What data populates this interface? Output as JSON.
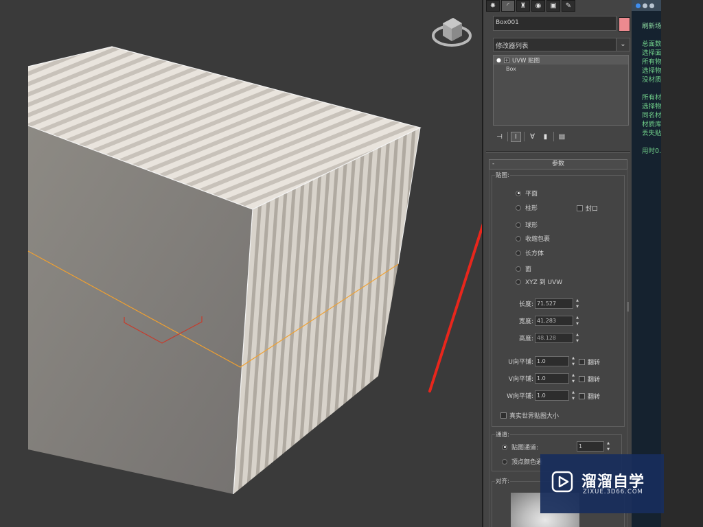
{
  "command_panel": {
    "tabs": [
      {
        "icon": "create-icon",
        "glyph": "✸"
      },
      {
        "icon": "modify-icon",
        "glyph": "◜"
      },
      {
        "icon": "hierarchy-icon",
        "glyph": "♜"
      },
      {
        "icon": "motion-icon",
        "glyph": "◉"
      },
      {
        "icon": "display-icon",
        "glyph": "▣"
      },
      {
        "icon": "utilities-icon",
        "glyph": "✎"
      }
    ],
    "object_name": "Box001",
    "object_color": "#ec8a8f",
    "modifier_list_label": "修改器列表",
    "modifier_stack": [
      {
        "label": "UVW 贴图"
      },
      {
        "label": "Box"
      }
    ],
    "parameters_rollout": {
      "title": "参数",
      "mapping_group_label": "贴图:",
      "mapping_options": [
        "平面",
        "柱形",
        "球形",
        "收缩包裹",
        "长方体",
        "面",
        "XYZ 到 UVW"
      ],
      "selected_mapping": "平面",
      "cap_label": "封口",
      "length_label": "长度:",
      "length_value": "71.527",
      "width_label": "宽度:",
      "width_value": "41.283",
      "height_label": "高度:",
      "height_value": "48.128",
      "u_tile_label": "U向平铺:",
      "u_tile_value": "1.0",
      "v_tile_label": "V向平铺:",
      "v_tile_value": "1.0",
      "w_tile_label": "W向平铺:",
      "w_tile_value": "1.0",
      "flip_label": "翻转",
      "real_world_label": "真实世界贴图大小",
      "channel_group_label": "通道:",
      "map_channel_label": "贴图通道:",
      "map_channel_value": "1",
      "vertex_color_label": "顶点颜色通",
      "alignment_group_label": "对齐:"
    }
  },
  "info_strip": {
    "header": "刷新场",
    "lines_1": [
      "总面数",
      "选择面",
      "所有物",
      "选择物",
      "没材质"
    ],
    "lines_2": [
      "所有材",
      "选择物",
      "同名材",
      "材质库",
      "丢失贴"
    ],
    "time_line": "用时0."
  },
  "watermark": {
    "title": "溜溜自学",
    "subtitle": "ZIXUE.3D66.COM"
  },
  "colors": {
    "viewport_bg": "#3a3a3a",
    "panel_bg": "#444444",
    "selection_edge": "#f0a030",
    "annotation_arrow": "#e8261c",
    "watermark_bg": "#182e5c"
  }
}
